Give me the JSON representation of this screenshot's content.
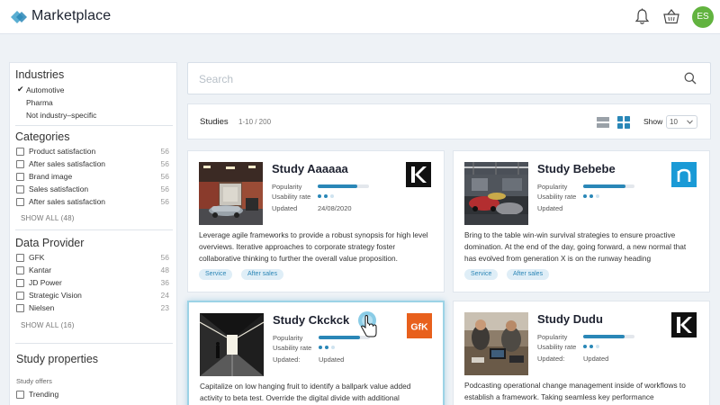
{
  "app": {
    "brand": "Marketplace",
    "avatar_initials": "ES",
    "accent": "#2a87b7",
    "avatar_color": "#62b33f",
    "icons": [
      "logo-icon",
      "bell-icon",
      "basket-icon"
    ]
  },
  "sidebar": {
    "industries": {
      "title": "Industries",
      "options": [
        {
          "label": "Automotive",
          "checked": true
        },
        {
          "label": "Pharma",
          "checked": false
        },
        {
          "label": "Not industry–specific",
          "checked": false
        }
      ]
    },
    "categories": {
      "title": "Categories",
      "items": [
        {
          "label": "Product satisfaction",
          "count": "56"
        },
        {
          "label": "After sales satisfaction",
          "count": "56"
        },
        {
          "label": "Brand image",
          "count": "56"
        },
        {
          "label": "Sales satisfaction",
          "count": "56"
        },
        {
          "label": "After sales satisfaction",
          "count": "56"
        }
      ],
      "show_all": "SHOW ALL (48)"
    },
    "data_provider": {
      "title": "Data Provider",
      "items": [
        {
          "label": "GFK",
          "count": "56"
        },
        {
          "label": "Kantar",
          "count": "48"
        },
        {
          "label": "JD Power",
          "count": "36"
        },
        {
          "label": "Strategic Vision",
          "count": "24"
        },
        {
          "label": "Nielsen",
          "count": "23"
        }
      ],
      "show_all": "SHOW ALL (16)"
    },
    "study_properties": {
      "title": "Study properties",
      "offers_label": "Study offers",
      "items": [
        {
          "label": "Trending"
        }
      ]
    }
  },
  "search": {
    "placeholder": "Search",
    "value": ""
  },
  "studies_bar": {
    "title": "Studies",
    "range": "1-10 / 200",
    "show_label": "Show",
    "show_value": "10",
    "active_view": "grid"
  },
  "cards": [
    {
      "title": "Study Aaaaaa",
      "logo": "K",
      "popularity_label": "Popularity",
      "popularity": 0.78,
      "usability_label": "Usability rate",
      "usability": 2,
      "updated_label": "Updated",
      "updated": "24/08/2020",
      "description": "Leverage agile frameworks to provide a robust synopsis for high level overviews. Iterative approaches to corporate strategy foster collaborative thinking to further the overall value proposition.",
      "tags": [
        "Service",
        "After sales"
      ]
    },
    {
      "title": "Study Bebebe",
      "logo": "n",
      "popularity_label": "Popularity",
      "popularity": 0.82,
      "usability_label": "Usability rate",
      "usability": 2,
      "updated_label": "Updated",
      "updated": "",
      "description": "Bring to the table win-win survival strategies to ensure proactive domination. At the end of the day, going forward, a new normal that has evolved from generation X is on the runway heading",
      "tags": [
        "Service",
        "After sales"
      ]
    },
    {
      "title": "Study Ckckck",
      "logo": "GfK",
      "popularity_label": "Popularity",
      "popularity": 0.8,
      "usability_label": "Usability rate",
      "usability": 2,
      "updated_label": "Updated:",
      "updated": "Updated",
      "description": "Capitalize on low hanging fruit to identify a ballpark value added activity to beta test. Override the digital divide with additional",
      "tags": []
    },
    {
      "title": "Study Dudu",
      "logo": "K",
      "popularity_label": "Popularity",
      "popularity": 0.8,
      "usability_label": "Usability rate",
      "usability": 2,
      "updated_label": "Updated:",
      "updated": "Updated",
      "description": "Podcasting operational change management inside of workflows to establish a framework. Taking seamless key performance",
      "tags": []
    }
  ]
}
